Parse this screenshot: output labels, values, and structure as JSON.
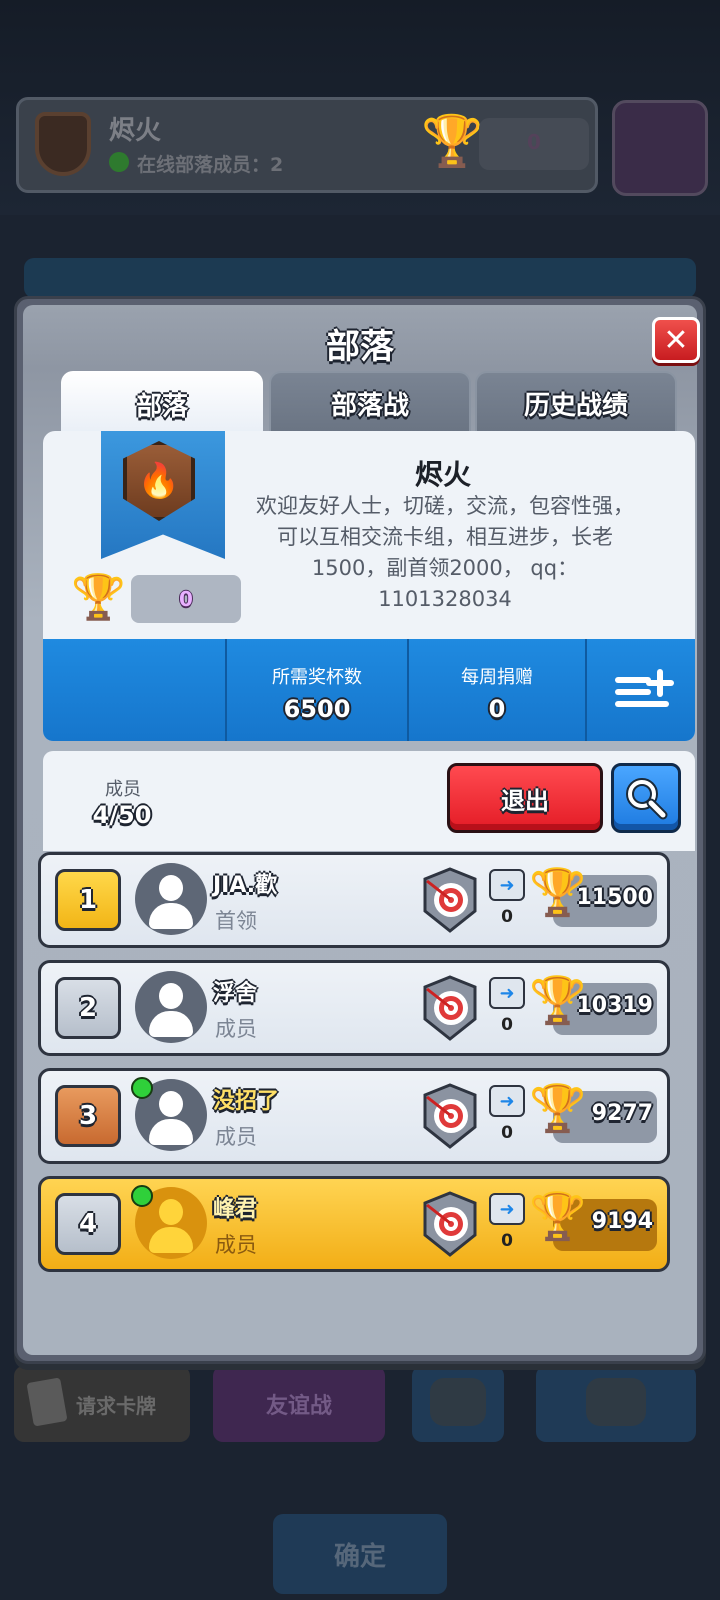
{
  "background": {
    "clan_name": "烬火",
    "online_text": "在线部落成员：2",
    "trophies": "0",
    "request_cards": "请求卡牌",
    "friendly_battle": "友谊战",
    "confirm": "确定"
  },
  "modal": {
    "title": "部落",
    "tabs": [
      "部落",
      "部落战",
      "历史战绩"
    ]
  },
  "clan": {
    "name": "烬火",
    "description": "欢迎友好人士，切磋，交流，包容性强，可以互相交流卡组，相互进步，长老1500，副首领2000， qq：1101328034",
    "trophies": "0",
    "required_trophies_label": "所需奖杯数",
    "required_trophies": "6500",
    "weekly_donations_label": "每周捐赠",
    "weekly_donations": "0"
  },
  "members_section": {
    "label": "成员",
    "count": "4/50",
    "leave_label": "退出"
  },
  "members": [
    {
      "rank": "1",
      "name": "JIA.歡",
      "role": "首领",
      "donations": "0",
      "trophies": "11500",
      "online": false
    },
    {
      "rank": "2",
      "name": "浮舍",
      "role": "成员",
      "donations": "0",
      "trophies": "10319",
      "online": false
    },
    {
      "rank": "3",
      "name": "没招了",
      "role": "成员",
      "donations": "0",
      "trophies": "9277",
      "online": true
    },
    {
      "rank": "4",
      "name": "峰君",
      "role": "成员",
      "donations": "0",
      "trophies": "9194",
      "online": true
    }
  ],
  "colors": {
    "accent_blue": "#1f8ae0",
    "leave_red": "#e41c26",
    "self_row_gold": "#f2ae16",
    "online_green": "#2fd03a"
  }
}
